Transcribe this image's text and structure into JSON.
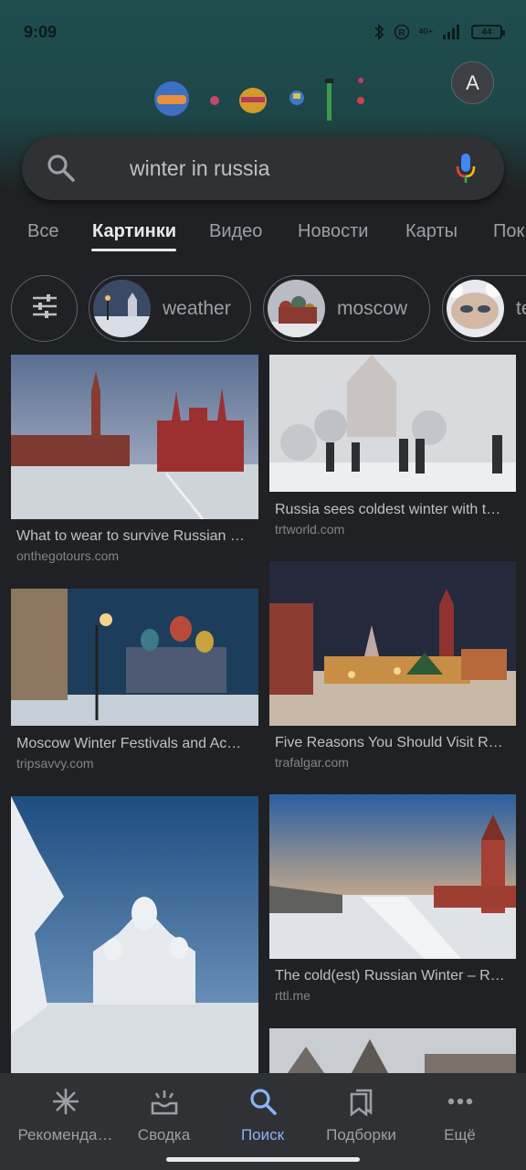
{
  "status_bar": {
    "time": "9:09",
    "network": "4G+",
    "battery": "44"
  },
  "account": {
    "avatar_letter": "A"
  },
  "search": {
    "query": "winter in russia"
  },
  "tabs": [
    {
      "label": "Все"
    },
    {
      "label": "Картинки",
      "active": true
    },
    {
      "label": "Видео"
    },
    {
      "label": "Новости"
    },
    {
      "label": "Карты"
    },
    {
      "label": "Пок"
    }
  ],
  "chips": [
    {
      "label": "weather"
    },
    {
      "label": "moscow"
    },
    {
      "label": "te"
    }
  ],
  "results": [
    {
      "title": "What to wear to survive Russian …",
      "source": "onthegotours.com"
    },
    {
      "title": "Russia sees coldest winter with t…",
      "source": "trtworld.com"
    },
    {
      "title": "Moscow Winter Festivals and Ac…",
      "source": "tripsavvy.com"
    },
    {
      "title": "Five Reasons You Should Visit R…",
      "source": "trafalgar.com"
    },
    {
      "title": "",
      "source": ""
    },
    {
      "title": "The cold(est) Russian Winter – R…",
      "source": "rttl.me"
    },
    {
      "title": "",
      "source": ""
    }
  ],
  "bottom_nav": [
    {
      "label": "Рекоменда…",
      "icon": "asterisk-icon"
    },
    {
      "label": "Сводка",
      "icon": "inbox-icon"
    },
    {
      "label": "Поиск",
      "icon": "search-icon",
      "active": true
    },
    {
      "label": "Подборки",
      "icon": "collections-icon"
    },
    {
      "label": "Ещё",
      "icon": "more-dots-icon"
    }
  ],
  "colors": {
    "background": "#202124",
    "accent": "#8ab4f8",
    "header": "#1f4e4f"
  }
}
